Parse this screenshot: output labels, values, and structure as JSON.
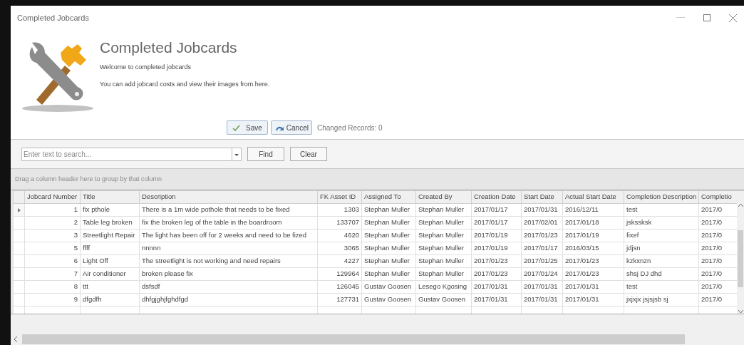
{
  "window": {
    "title": "Completed Jobcards"
  },
  "header": {
    "title": "Completed Jobcards",
    "welcome": "Welcome to completed jobcards",
    "subtitle": "You can add jobcard costs and view their images from here."
  },
  "actions": {
    "save": "Save",
    "cancel": "Cancel",
    "changed_records": "Changed Records: 0"
  },
  "search": {
    "placeholder": "Enter text to search...",
    "find": "Find",
    "clear": "Clear"
  },
  "group_panel": {
    "hint": "Drag a column header here to group by that column"
  },
  "table": {
    "columns": [
      "Jobcard Number",
      "Title",
      "Description",
      "FK Asset ID",
      "Assigned To",
      "Created By",
      "Creation Date",
      "Start Date",
      "Actual Start Date",
      "Completion Description",
      "Completio"
    ],
    "rows": [
      {
        "selected": true,
        "cells": [
          "1",
          "fix pthole",
          "There is a 1m wide pothole that needs to be fixed",
          "1303",
          "Stephan Muller",
          "Stephan Muller",
          "2017/01/17",
          "2017/01/31",
          "2016/12/11",
          "test",
          "2017/0"
        ]
      },
      {
        "selected": false,
        "cells": [
          "2",
          "Table leg broken",
          "fix the broken leg of the table in the boardroom",
          "133707",
          "Stephan Muller",
          "Stephan Muller",
          "2017/01/17",
          "2017/02/01",
          "2017/01/18",
          "jskssksk",
          "2017/0"
        ]
      },
      {
        "selected": false,
        "cells": [
          "3",
          "Streetlight Repair",
          "The light has been off for 2 weeks and need to be fized",
          "4620",
          "Stephan Muller",
          "Stephan Muller",
          "2017/01/19",
          "2017/01/23",
          "2017/01/19",
          "fixef",
          "2017/0"
        ]
      },
      {
        "selected": false,
        "cells": [
          "5",
          "ffff",
          "nnnnn",
          "3065",
          "Stephan Muller",
          "Stephan Muller",
          "2017/01/19",
          "2017/01/17",
          "2016/03/15",
          "jdjsn",
          "2017/0"
        ]
      },
      {
        "selected": false,
        "cells": [
          "6",
          "Light Off",
          "The streetlight is not working and need repairs",
          "4227",
          "Stephan Muller",
          "Stephan Muller",
          "2017/01/23",
          "2017/01/25",
          "2017/01/23",
          "kzkxnzn",
          "2017/0"
        ]
      },
      {
        "selected": false,
        "cells": [
          "7",
          "Air conditioner",
          "broken please fix",
          "129964",
          "Stephan Muller",
          "Stephan Muller",
          "2017/01/23",
          "2017/01/24",
          "2017/01/23",
          "shsj DJ dhd",
          "2017/0"
        ]
      },
      {
        "selected": false,
        "cells": [
          "8",
          "ttt",
          "dsfsdf",
          "126045",
          "Gustav Goosen",
          "Lesego Kgosing",
          "2017/01/31",
          "2017/01/31",
          "2017/01/31",
          "test",
          "2017/0"
        ]
      },
      {
        "selected": false,
        "cells": [
          "9",
          "dfgdfh",
          "dhfgjghjfghdfgd",
          "127731",
          "Gustav Goosen",
          "Gustav Goosen",
          "2017/01/31",
          "2017/01/31",
          "2017/01/31",
          "jxjxjx jsjsjsb sj",
          "2017/0"
        ]
      }
    ]
  }
}
